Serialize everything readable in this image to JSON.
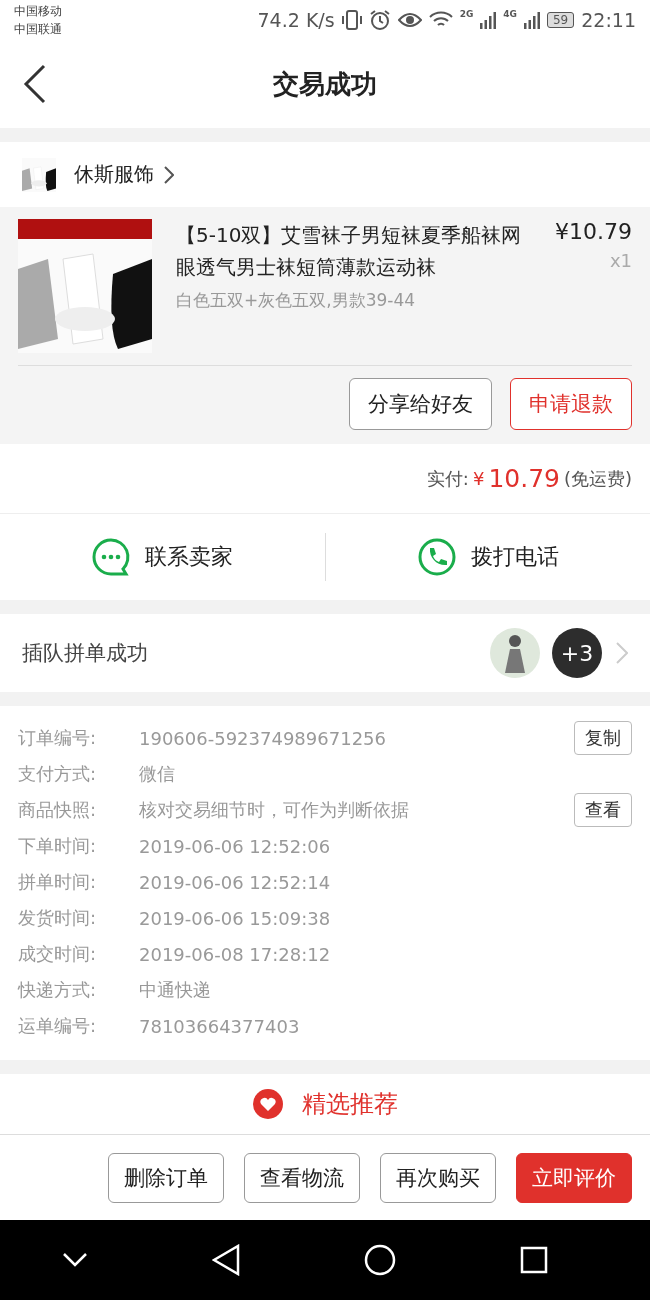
{
  "status_bar": {
    "carriers": [
      "中国移动",
      "中国联通"
    ],
    "speed": "74.2 K/s",
    "signal_labels": [
      "2G",
      "4G"
    ],
    "battery": "59",
    "time": "22:11"
  },
  "header": {
    "title": "交易成功"
  },
  "shop": {
    "name": "休斯服饰"
  },
  "product": {
    "title": "【5-10双】艾雪袜子男短袜夏季船袜网眼透气男士袜短筒薄款运动袜",
    "spec": "白色五双+灰色五双,男款39-44",
    "price": "¥10.79",
    "qty": "x1",
    "buttons": [
      {
        "label": "分享给好友",
        "kind": "plain"
      },
      {
        "label": "申请退款",
        "kind": "accent"
      }
    ]
  },
  "payment": {
    "label": "实付:",
    "currency": "¥",
    "amount": "10.79",
    "note": "(免运费)"
  },
  "contact": [
    {
      "label": "联系卖家",
      "kind": "chat"
    },
    {
      "label": "拨打电话",
      "kind": "phone"
    }
  ],
  "group": {
    "title": "插队拼单成功",
    "more": "+3"
  },
  "details": [
    {
      "label": "订单编号:",
      "value": "190606-592374989671256",
      "action": "复制"
    },
    {
      "label": "支付方式:",
      "value": "微信"
    },
    {
      "label": "商品快照:",
      "value": "核对交易细节时，可作为判断依据",
      "action": "查看"
    },
    {
      "label": "下单时间:",
      "value": "2019-06-06 12:52:06"
    },
    {
      "label": "拼单时间:",
      "value": "2019-06-06 12:52:14"
    },
    {
      "label": "发货时间:",
      "value": "2019-06-06 15:09:38"
    },
    {
      "label": "成交时间:",
      "value": "2019-06-08 17:28:12"
    },
    {
      "label": "快递方式:",
      "value": "中通快递"
    },
    {
      "label": "运单编号:",
      "value": "78103664377403"
    }
  ],
  "recommend": {
    "title": "精选推荐"
  },
  "actions": [
    {
      "label": "删除订单",
      "kind": "plain"
    },
    {
      "label": "查看物流",
      "kind": "plain"
    },
    {
      "label": "再次购买",
      "kind": "plain"
    },
    {
      "label": "立即评价",
      "kind": "primary"
    }
  ]
}
